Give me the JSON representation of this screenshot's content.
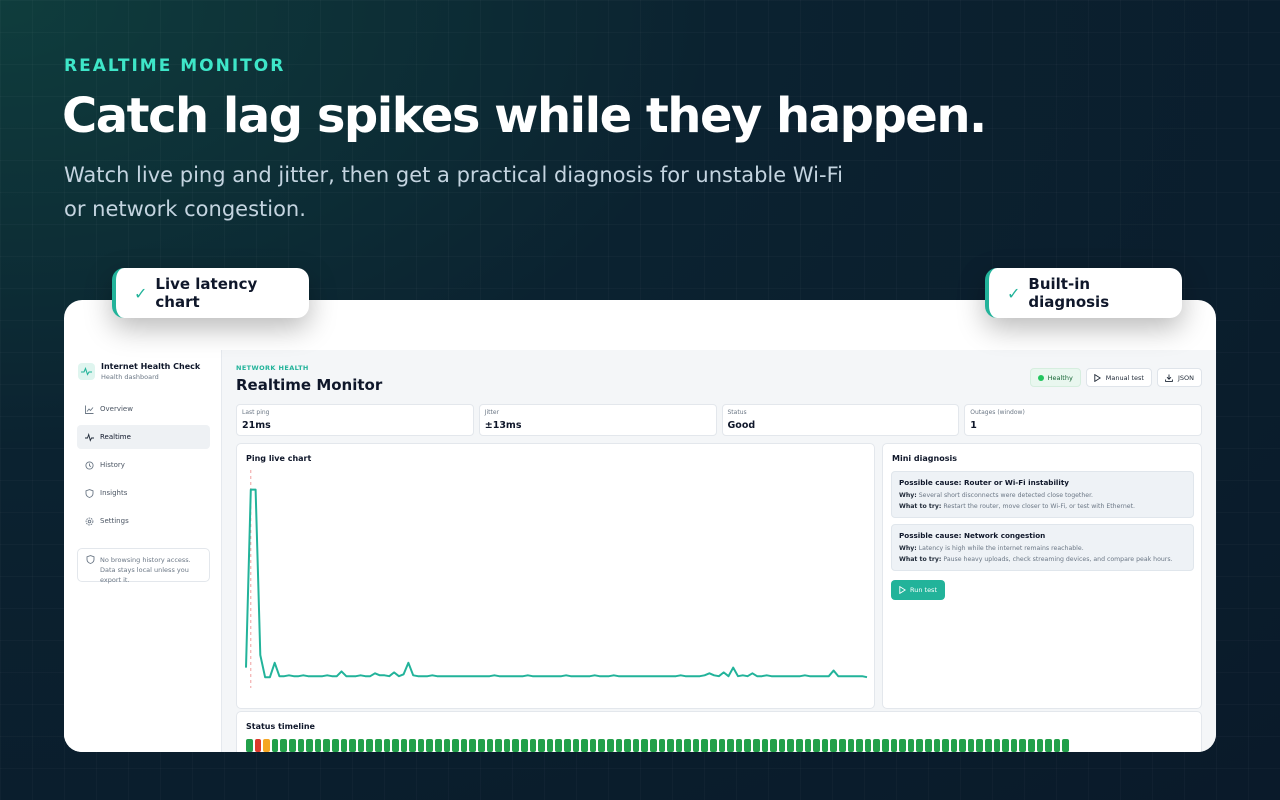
{
  "hero": {
    "eyebrow": "REALTIME MONITOR",
    "headline": "Catch lag spikes while they happen.",
    "subhead": "Watch live ping and jitter, then get a practical diagnosis for unstable Wi-Fi or network congestion."
  },
  "badges": {
    "check_glyph": "✓",
    "left_label": "Live latency chart",
    "right_label": "Built-in diagnosis"
  },
  "sidebar": {
    "brand_title": "Internet Health Check",
    "brand_subtitle": "Health dashboard",
    "items": [
      {
        "label": "Overview",
        "icon": "chart-icon"
      },
      {
        "label": "Realtime",
        "icon": "pulse-icon",
        "active": true
      },
      {
        "label": "History",
        "icon": "history-icon"
      },
      {
        "label": "Insights",
        "icon": "shield-icon"
      },
      {
        "label": "Settings",
        "icon": "gear-icon"
      }
    ],
    "privacy_note": "No browsing history access. Data stays local unless you export it."
  },
  "header": {
    "eyebrow": "NETWORK HEALTH",
    "title": "Realtime Monitor",
    "status_label": "Healthy",
    "manual_test_label": "Manual test",
    "json_label": "JSON"
  },
  "stats": [
    {
      "label": "Last ping",
      "value": "21ms"
    },
    {
      "label": "Jitter",
      "value": "±13ms"
    },
    {
      "label": "Status",
      "value": "Good"
    },
    {
      "label": "Outages (window)",
      "value": "1"
    }
  ],
  "chart_data": {
    "type": "line",
    "title": "Ping live chart",
    "xlabel": "",
    "ylabel": "",
    "ylim": [
      0,
      210
    ],
    "grid": false,
    "legend": "none",
    "line_color": "#22b39a",
    "marker_color": "#f0a0a0",
    "marker_index": 1,
    "values": [
      15,
      200,
      200,
      28,
      5,
      5,
      20,
      6,
      6,
      7,
      6,
      6,
      7,
      6,
      6,
      6,
      6,
      7,
      6,
      6,
      11,
      6,
      6,
      6,
      7,
      6,
      6,
      9,
      7,
      7,
      6,
      10,
      6,
      8,
      20,
      7,
      6,
      6,
      6,
      7,
      6,
      6,
      6,
      6,
      6,
      6,
      6,
      6,
      6,
      6,
      6,
      6,
      7,
      6,
      6,
      6,
      6,
      6,
      6,
      7,
      6,
      6,
      6,
      6,
      6,
      6,
      6,
      7,
      6,
      6,
      6,
      6,
      6,
      7,
      6,
      6,
      6,
      7,
      6,
      6,
      6,
      6,
      6,
      6,
      6,
      6,
      6,
      6,
      6,
      6,
      6,
      7,
      6,
      6,
      6,
      6,
      7,
      9,
      7,
      6,
      10,
      6,
      15,
      6,
      7,
      6,
      9,
      6,
      6,
      7,
      6,
      6,
      6,
      6,
      6,
      6,
      6,
      7,
      6,
      6,
      6,
      6,
      6,
      12,
      6,
      6,
      6,
      6,
      6,
      6,
      5
    ]
  },
  "diagnosis": {
    "title": "Mini diagnosis",
    "why_label": "Why:",
    "try_label": "What to try:",
    "items": [
      {
        "title": "Possible cause: Router or Wi-Fi instability",
        "why": "Several short disconnects were detected close together.",
        "try": "Restart the router, move closer to Wi-Fi, or test with Ethernet."
      },
      {
        "title": "Possible cause: Network congestion",
        "why": "Latency is high while the internet remains reachable.",
        "try": "Pause heavy uploads, check streaming devices, and compare peak hours."
      }
    ],
    "run_label": "Run test"
  },
  "timeline": {
    "title": "Status timeline",
    "colors": {
      "ok": "#22a04a",
      "bad": "#dc3a2a",
      "warn": "#f5a623"
    },
    "states": [
      "ok",
      "bad",
      "warn",
      "ok",
      "ok",
      "ok",
      "ok",
      "ok",
      "ok",
      "ok",
      "ok",
      "ok",
      "ok",
      "ok",
      "ok",
      "ok",
      "ok",
      "ok",
      "ok",
      "ok",
      "ok",
      "ok",
      "ok",
      "ok",
      "ok",
      "ok",
      "ok",
      "ok",
      "ok",
      "ok",
      "ok",
      "ok",
      "ok",
      "ok",
      "ok",
      "ok",
      "ok",
      "ok",
      "ok",
      "ok",
      "ok",
      "ok",
      "ok",
      "ok",
      "ok",
      "ok",
      "ok",
      "ok",
      "ok",
      "ok",
      "ok",
      "ok",
      "ok",
      "ok",
      "ok",
      "ok",
      "ok",
      "ok",
      "ok",
      "ok",
      "ok",
      "ok",
      "ok",
      "ok",
      "ok",
      "ok",
      "ok",
      "ok",
      "ok",
      "ok",
      "ok",
      "ok",
      "ok",
      "ok",
      "ok",
      "ok",
      "ok",
      "ok",
      "ok",
      "ok",
      "ok",
      "ok",
      "ok",
      "ok",
      "ok",
      "ok",
      "ok",
      "ok",
      "ok",
      "ok",
      "ok",
      "ok",
      "ok",
      "ok",
      "ok",
      "ok"
    ]
  }
}
